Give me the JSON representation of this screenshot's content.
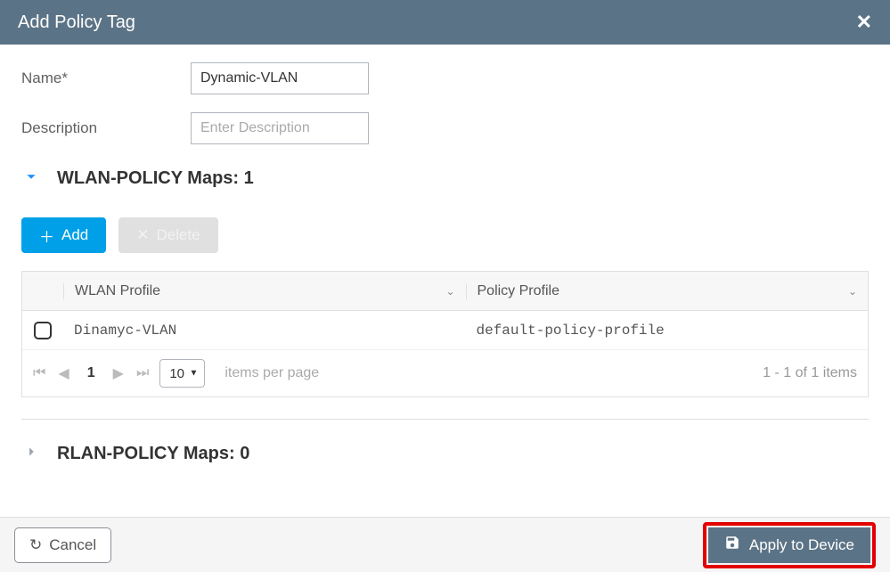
{
  "header": {
    "title": "Add Policy Tag"
  },
  "form": {
    "name_label": "Name*",
    "name_value": "Dynamic-VLAN",
    "desc_label": "Description",
    "desc_placeholder": "Enter Description",
    "desc_value": ""
  },
  "sections": {
    "wlan": {
      "title": "WLAN-POLICY Maps: 1"
    },
    "rlan": {
      "title": "RLAN-POLICY Maps: 0"
    }
  },
  "actions": {
    "add": "Add",
    "delete": "Delete"
  },
  "table": {
    "headers": {
      "wlan_profile": "WLAN Profile",
      "policy_profile": "Policy Profile"
    },
    "rows": [
      {
        "wlan_profile": "Dinamyc-VLAN",
        "policy_profile": "default-policy-profile"
      }
    ]
  },
  "pager": {
    "current_page": "1",
    "page_size": "10",
    "items_per_page": "items per page",
    "range": "1 - 1 of 1 items"
  },
  "footer": {
    "cancel": "Cancel",
    "apply": "Apply to Device"
  }
}
